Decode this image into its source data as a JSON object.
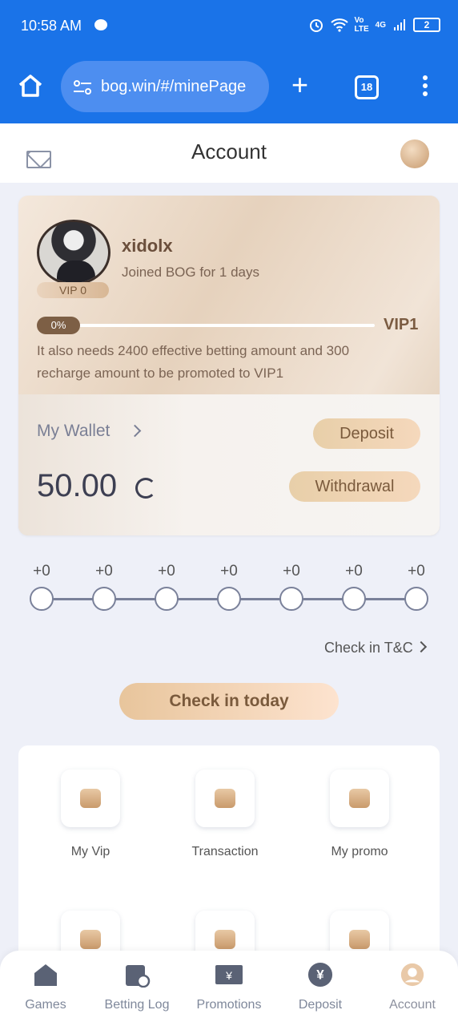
{
  "status": {
    "time": "10:58 AM",
    "network": "4G",
    "battery": "2"
  },
  "browser": {
    "url": "bog.win/#/minePage",
    "tab_count": "18"
  },
  "header": {
    "title": "Account"
  },
  "profile": {
    "username": "xidolx",
    "joined": "Joined BOG for 1 days",
    "vip_level": "VIP 0",
    "progress_label": "0%",
    "progress": 0,
    "next_vip": "VIP1",
    "requirement": "It also needs 2400 effective betting amount and 300 recharge amount to be promoted to VIP1"
  },
  "wallet": {
    "label": "My Wallet",
    "balance": "50.00",
    "deposit_label": "Deposit",
    "withdraw_label": "Withdrawal"
  },
  "checkin": {
    "days": [
      "+0",
      "+0",
      "+0",
      "+0",
      "+0",
      "+0",
      "+0"
    ],
    "tc_label": "Check in T&C",
    "button_label": "Check in today"
  },
  "menu": {
    "items": [
      {
        "label": "My Vip",
        "icon": "crown-icon"
      },
      {
        "label": "Transaction",
        "icon": "list-icon"
      },
      {
        "label": "My promo",
        "icon": "chest-icon"
      },
      {
        "label": "",
        "icon": "calendar-icon"
      },
      {
        "label": "",
        "icon": "check-icon"
      },
      {
        "label": "",
        "icon": "robot-icon"
      }
    ]
  },
  "tabbar": {
    "items": [
      {
        "label": "Games",
        "icon": "home-icon"
      },
      {
        "label": "Betting Log",
        "icon": "calendar-clock-icon"
      },
      {
        "label": "Promotions",
        "icon": "ticket-icon"
      },
      {
        "label": "Deposit",
        "icon": "yen-icon"
      },
      {
        "label": "Account",
        "icon": "user-icon"
      }
    ],
    "active": "Account"
  },
  "colors": {
    "browser_blue": "#1a73e8",
    "gold_dark": "#7a5a3c",
    "gold_light": "#f5d8bc",
    "background": "#eef0f8"
  }
}
